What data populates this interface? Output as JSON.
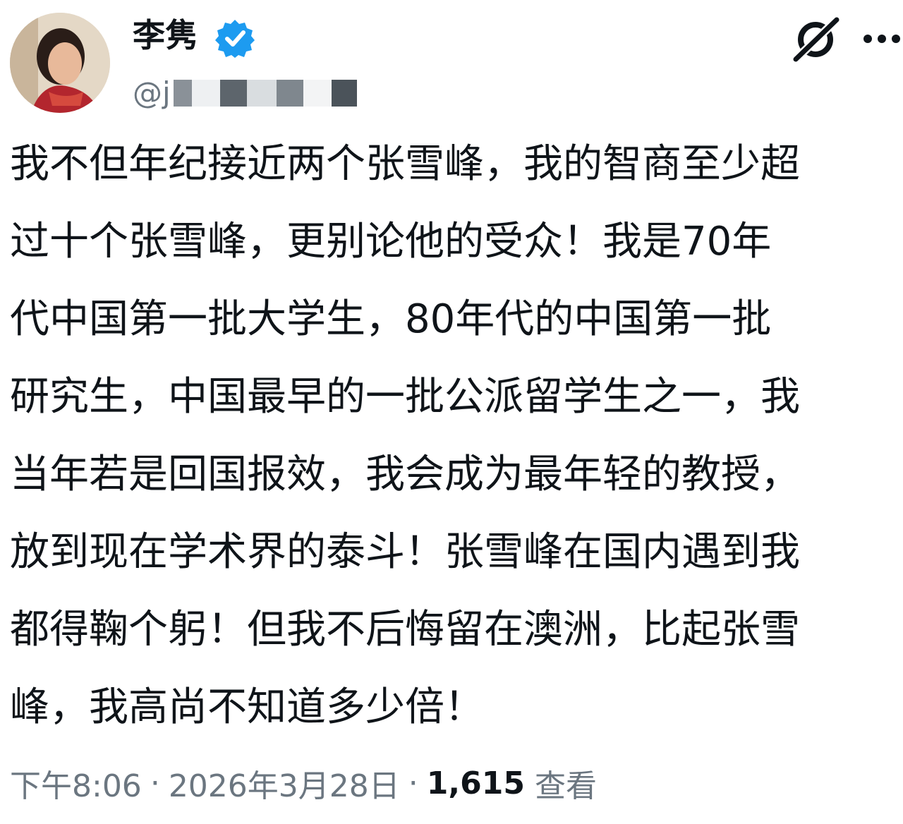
{
  "author": {
    "display_name": "李隽",
    "handle_visible": "@j",
    "verified_color": "#1d9bf0"
  },
  "actions": {
    "grok_icon": "grok-icon",
    "more_icon": "more-icon"
  },
  "post": {
    "lines": [
      "我不但年纪接近两个张雪峰，我的智商至少超",
      "过十个张雪峰，更别论他的受众！我是70年",
      "代中国第一批大学生，80年代的中国第一批",
      "研究生，中国最早的一批公派留学生之一，我",
      "当年若是回国报效，我会成为最年轻的教授，",
      "放到现在学术界的泰斗！张雪峰在国内遇到我",
      "都得鞠个躬！但我不后悔留在澳洲，比起张雪",
      "峰，我高尚不知道多少倍！"
    ]
  },
  "meta": {
    "time": "下午8:06",
    "separator": "·",
    "date": "2026年3月28日",
    "views_count": "1,615",
    "views_label": "查看"
  }
}
